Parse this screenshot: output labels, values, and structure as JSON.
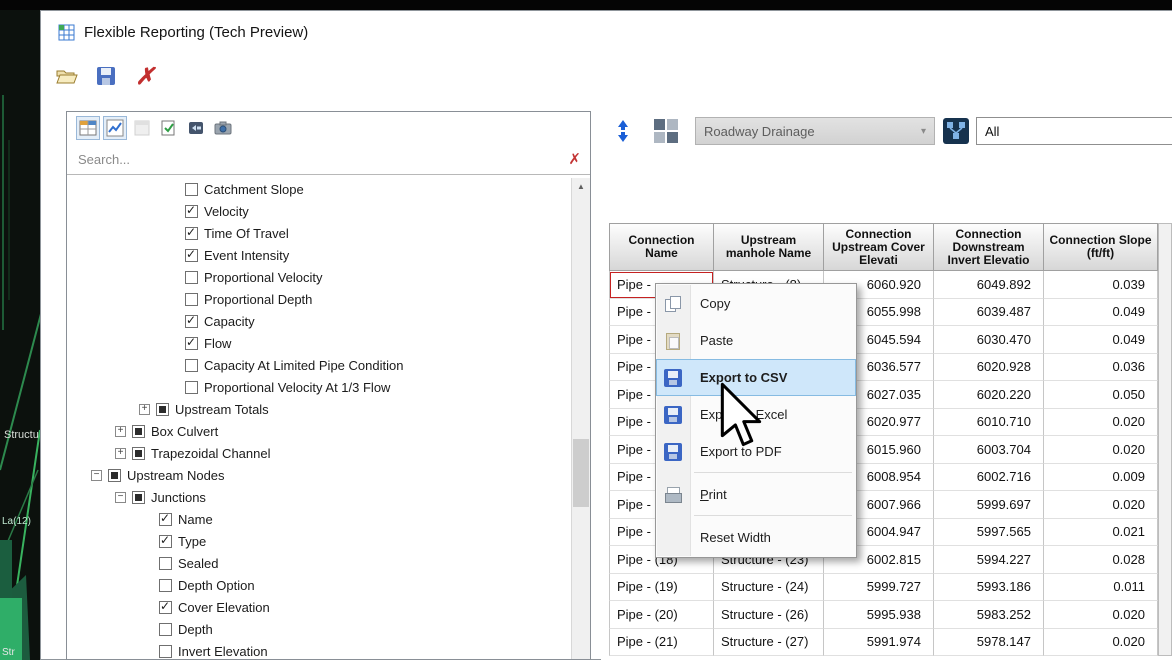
{
  "window": {
    "title": "Flexible Reporting (Tech Preview)"
  },
  "glyphs": {
    "delete_x": "✗",
    "search_clear": "✗",
    "dropdown_arrow": "▾",
    "scroll_up": "▲",
    "expand": "+",
    "collapse": "−"
  },
  "left_panel": {
    "search": {
      "placeholder": "Search..."
    },
    "tree": [
      {
        "label": "Catchment Slope",
        "state": "unchecked",
        "indent": 118
      },
      {
        "label": "Velocity",
        "state": "checked",
        "indent": 118
      },
      {
        "label": "Time Of Travel",
        "state": "checked",
        "indent": 118
      },
      {
        "label": "Event Intensity",
        "state": "checked",
        "indent": 118
      },
      {
        "label": "Proportional Velocity",
        "state": "unchecked",
        "indent": 118
      },
      {
        "label": "Proportional Depth",
        "state": "unchecked",
        "indent": 118
      },
      {
        "label": "Capacity",
        "state": "checked",
        "indent": 118
      },
      {
        "label": "Flow",
        "state": "checked",
        "indent": 118
      },
      {
        "label": "Capacity At Limited Pipe Condition",
        "state": "unchecked",
        "indent": 118
      },
      {
        "label": "Proportional Velocity At 1/3 Flow",
        "state": "unchecked",
        "indent": 118
      },
      {
        "label": "Upstream Totals",
        "state": "filled",
        "indent": 72,
        "expander": "plus"
      },
      {
        "label": "Box Culvert",
        "state": "filled",
        "indent": 48,
        "expander": "plus"
      },
      {
        "label": "Trapezoidal Channel",
        "state": "filled",
        "indent": 48,
        "expander": "plus"
      },
      {
        "label": "Upstream Nodes",
        "state": "filled",
        "indent": 24,
        "expander": "minus"
      },
      {
        "label": "Junctions",
        "state": "filled",
        "indent": 48,
        "expander": "minus"
      },
      {
        "label": "Name",
        "state": "checked",
        "indent": 92
      },
      {
        "label": "Type",
        "state": "checked",
        "indent": 92
      },
      {
        "label": "Sealed",
        "state": "unchecked",
        "indent": 92
      },
      {
        "label": "Depth Option",
        "state": "unchecked",
        "indent": 92
      },
      {
        "label": "Cover Elevation",
        "state": "checked",
        "indent": 92
      },
      {
        "label": "Depth",
        "state": "unchecked",
        "indent": 92
      },
      {
        "label": "Invert Elevation",
        "state": "unchecked",
        "indent": 92
      }
    ]
  },
  "right_panel": {
    "scope_dropdown": "Roadway Drainage",
    "filter_dropdown": "All",
    "table": {
      "headers": [
        "Connection Name",
        "Upstream manhole Name",
        "Connection Upstream Cover Elevati",
        "Connection Downstream Invert Elevatio",
        "Connection Slope (ft/ft)"
      ],
      "rows": [
        {
          "name": "Pipe -",
          "manhole": "Structure - (8)",
          "cover": "6060.920",
          "invert": "6049.892",
          "slope": "0.039",
          "selected": true
        },
        {
          "name": "Pipe -",
          "manhole": "",
          "cover": "6055.998",
          "invert": "6039.487",
          "slope": "0.049"
        },
        {
          "name": "Pipe -",
          "manhole": "",
          "cover": "6045.594",
          "invert": "6030.470",
          "slope": "0.049"
        },
        {
          "name": "Pipe -",
          "manhole": "",
          "cover": "6036.577",
          "invert": "6020.928",
          "slope": "0.036"
        },
        {
          "name": "Pipe -",
          "manhole": "",
          "cover": "6027.035",
          "invert": "6020.220",
          "slope": "0.050"
        },
        {
          "name": "Pipe -",
          "manhole": "",
          "cover": "6020.977",
          "invert": "6010.710",
          "slope": "0.020"
        },
        {
          "name": "Pipe -",
          "manhole": "",
          "cover": "6015.960",
          "invert": "6003.704",
          "slope": "0.020"
        },
        {
          "name": "Pipe -",
          "manhole": "",
          "cover": "6008.954",
          "invert": "6002.716",
          "slope": "0.009"
        },
        {
          "name": "Pipe -",
          "manhole": "",
          "cover": "6007.966",
          "invert": "5999.697",
          "slope": "0.020"
        },
        {
          "name": "Pipe -",
          "manhole": "",
          "cover": "6004.947",
          "invert": "5997.565",
          "slope": "0.021"
        },
        {
          "name": "Pipe - (18)",
          "manhole": "Structure - (23)",
          "cover": "6002.815",
          "invert": "5994.227",
          "slope": "0.028"
        },
        {
          "name": "Pipe - (19)",
          "manhole": "Structure - (24)",
          "cover": "5999.727",
          "invert": "5993.186",
          "slope": "0.011"
        },
        {
          "name": "Pipe - (20)",
          "manhole": "Structure - (26)",
          "cover": "5995.938",
          "invert": "5983.252",
          "slope": "0.020"
        },
        {
          "name": "Pipe - (21)",
          "manhole": "Structure - (27)",
          "cover": "5991.974",
          "invert": "5978.147",
          "slope": "0.020"
        }
      ]
    }
  },
  "context_menu": {
    "items": [
      {
        "label": "Copy",
        "icon": "copy-icon"
      },
      {
        "label": "Paste",
        "icon": "paste-icon"
      },
      {
        "label": "Export to CSV",
        "icon": "save-icon",
        "highlighted": true
      },
      {
        "label": "Export to Excel",
        "icon": "save-icon"
      },
      {
        "label": "Export to PDF",
        "icon": "save-icon"
      },
      {
        "label": "Print",
        "icon": "print-icon",
        "separator_before": true,
        "accel_underline": true
      },
      {
        "label": "Reset Width",
        "icon": null,
        "separator_before": true
      }
    ]
  },
  "background_labels": {
    "a": "Structu",
    "b": "La(12)",
    "c": "Str"
  }
}
